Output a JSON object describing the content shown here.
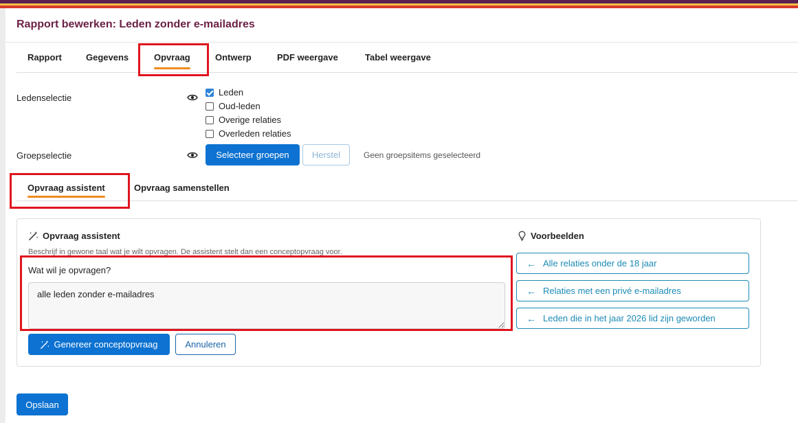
{
  "header": {
    "title": "Rapport bewerken: Leden zonder e-mailadres"
  },
  "main_tabs": [
    {
      "label": "Rapport"
    },
    {
      "label": "Gegevens"
    },
    {
      "label": "Opvraag"
    },
    {
      "label": "Ontwerp"
    },
    {
      "label": "PDF weergave"
    },
    {
      "label": "Tabel weergave"
    }
  ],
  "active_main_tab": "Opvraag",
  "member_selection": {
    "label": "Ledenselectie",
    "options": [
      {
        "label": "Leden",
        "checked": true
      },
      {
        "label": "Oud-leden",
        "checked": false
      },
      {
        "label": "Overige relaties",
        "checked": false
      },
      {
        "label": "Overleden relaties",
        "checked": false
      }
    ]
  },
  "group_selection": {
    "label": "Groepselectie",
    "select_button": "Selecteer groepen",
    "reset_button": "Herstel",
    "status": "Geen groepsitems geselecteerd"
  },
  "query_tabs": [
    {
      "label": "Opvraag assistent"
    },
    {
      "label": "Opvraag samenstellen"
    }
  ],
  "active_query_tab": "Opvraag assistent",
  "assistant": {
    "title": "Opvraag assistent",
    "help": "Beschrijf in gewone taal wat je wilt opvragen. De assistent stelt dan een conceptopvraag voor.",
    "field_label": "Wat wil je opvragen?",
    "field_value": "alle leden zonder e-mailadres",
    "generate_button": "Genereer conceptopvraag",
    "cancel_button": "Annuleren"
  },
  "examples": {
    "title": "Voorbeelden",
    "items": [
      {
        "label": "Alle relaties onder de 18 jaar"
      },
      {
        "label": "Relaties met een privé e-mailadres"
      },
      {
        "label": "Leden die in het jaar 2026 lid zijn geworden"
      }
    ]
  },
  "footer": {
    "save_button": "Opslaan"
  },
  "colors": {
    "title": "#6a1f44",
    "tab_underline": "#f08c1f",
    "primary": "#0d72d1",
    "highlight_box": "#e0141e",
    "example_border": "#1b8bb5"
  }
}
